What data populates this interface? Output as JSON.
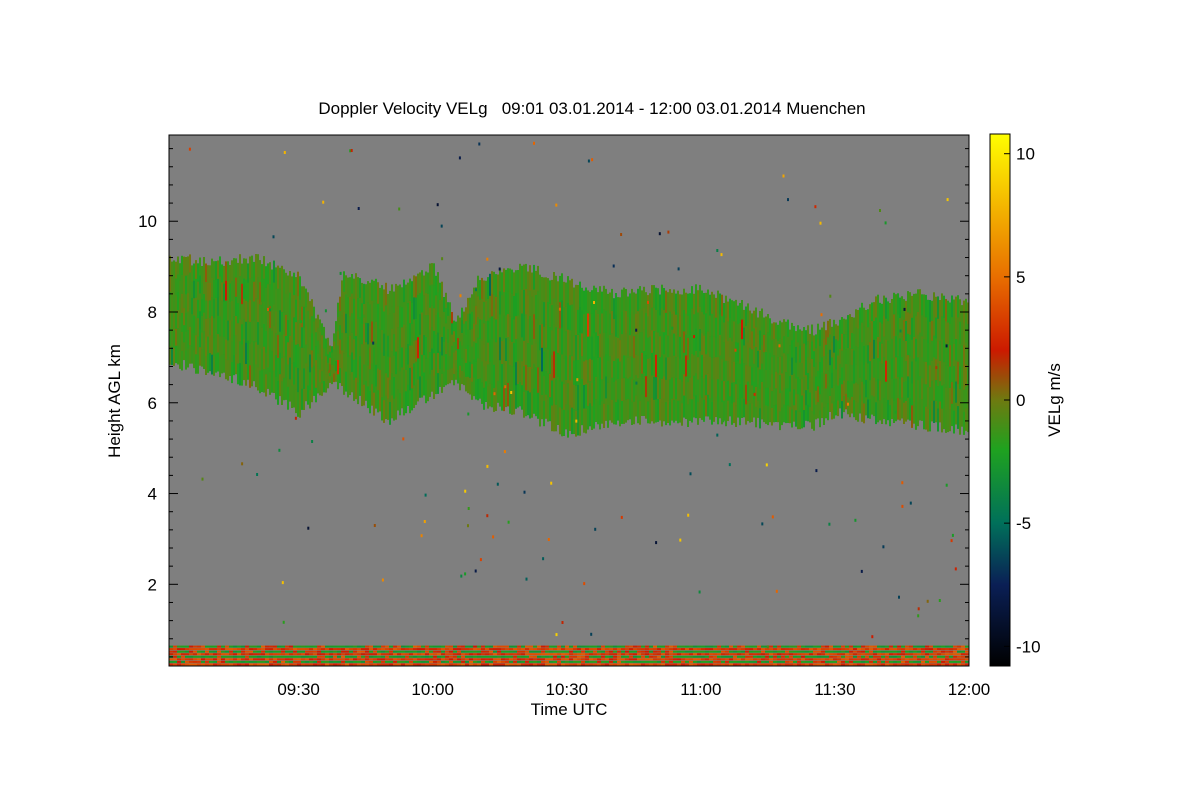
{
  "chart_data": {
    "type": "heatmap",
    "title": "Doppler Velocity VELg   09:01 03.01.2014 - 12:00 03.01.2014 Muenchen",
    "xlabel": "Time UTC",
    "ylabel": "Height AGL km",
    "xlim": [
      "09:01",
      "12:00"
    ],
    "ylim_km": [
      0.2,
      11.9
    ],
    "x_ticks": [
      "09:30",
      "10:00",
      "10:30",
      "11:00",
      "11:30",
      "12:00"
    ],
    "y_ticks": [
      2,
      4,
      6,
      8,
      10
    ],
    "background_color": "#7f7f7f",
    "colorbar": {
      "label": "VELg m/s",
      "range": [
        -10.8,
        10.8
      ],
      "ticks": [
        10,
        5,
        0,
        -5,
        -10
      ],
      "stops": [
        {
          "v": -10.8,
          "c": "#000000"
        },
        {
          "v": -7.5,
          "c": "#0a1f55"
        },
        {
          "v": -5.0,
          "c": "#00705a"
        },
        {
          "v": -2.0,
          "c": "#1fa21f"
        },
        {
          "v": 0.0,
          "c": "#6e7a10"
        },
        {
          "v": 2.0,
          "c": "#cc1a00"
        },
        {
          "v": 5.0,
          "c": "#e86e00"
        },
        {
          "v": 10.8,
          "c": "#ffff00"
        }
      ]
    },
    "cloud_layer": {
      "times": [
        "09:01",
        "09:10",
        "09:20",
        "09:30",
        "09:37",
        "09:40",
        "09:50",
        "10:00",
        "10:05",
        "10:10",
        "10:20",
        "10:30",
        "10:40",
        "10:50",
        "11:00",
        "11:10",
        "11:20",
        "11:25",
        "11:30",
        "11:40",
        "11:50",
        "12:00"
      ],
      "top_km": [
        9.2,
        9.1,
        9.2,
        8.8,
        7.2,
        8.9,
        8.5,
        9.0,
        7.8,
        8.7,
        9.0,
        8.7,
        8.4,
        8.5,
        8.5,
        8.1,
        7.7,
        7.6,
        7.8,
        8.3,
        8.4,
        8.2
      ],
      "base_km": [
        6.9,
        6.7,
        6.4,
        5.8,
        6.4,
        6.3,
        5.6,
        6.2,
        6.5,
        6.0,
        5.8,
        5.3,
        5.6,
        5.6,
        5.6,
        5.6,
        5.5,
        5.5,
        5.8,
        5.6,
        5.5,
        5.4
      ],
      "mean_velocity_ms": -1.2
    },
    "near_ground_clutter_km": [
      0.2,
      0.65
    ]
  }
}
